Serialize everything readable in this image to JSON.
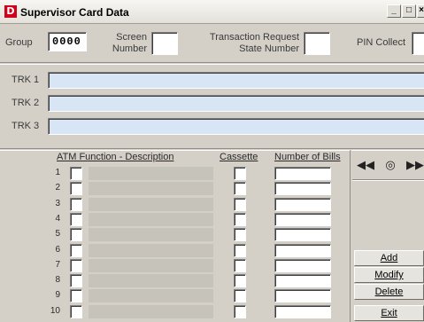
{
  "window": {
    "icon_letter": "D",
    "title": "Supervisor Card Data",
    "min_glyph": "_",
    "max_glyph": "□",
    "close_glyph": "×"
  },
  "header": {
    "group_label": "Group",
    "group_value": "0000",
    "screen_label_1": "Screen",
    "screen_label_2": "Number",
    "screen_value": "",
    "txn_label_1": "Transaction Request",
    "txn_label_2": "State Number",
    "txn_value": "",
    "pin_label": "PIN Collect",
    "pin_value": ""
  },
  "tracks": [
    {
      "label": "TRK 1",
      "value": ""
    },
    {
      "label": "TRK 2",
      "value": ""
    },
    {
      "label": "TRK 3",
      "value": ""
    }
  ],
  "grid": {
    "col_function": "ATM Function - Description",
    "col_cassette": "Cassette",
    "col_bills": "Number of Bills",
    "rows": [
      "1",
      "2",
      "3",
      "4",
      "5",
      "6",
      "7",
      "8",
      "9",
      "10"
    ]
  },
  "nav": {
    "prev": "◀◀",
    "center": "◎",
    "next": "▶▶"
  },
  "actions": {
    "add": "Add",
    "modify": "Modify",
    "delete": "Delete",
    "exit": "Exit"
  },
  "colors": {
    "track_field_bg": "#d7e5f4",
    "window_bg": "#d4d0c8",
    "app_icon_bg": "#d0021b"
  }
}
